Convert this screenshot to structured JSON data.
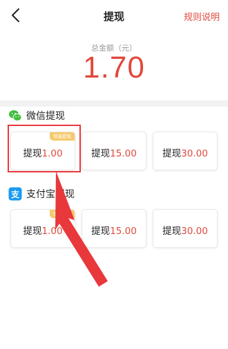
{
  "nav": {
    "title": "提现",
    "rules_label": "规则说明"
  },
  "summary": {
    "label": "总金额（元）",
    "amount": "1.70"
  },
  "wechat": {
    "title": "微信提现",
    "options": [
      {
        "prefix": "提现",
        "amount": "1.00",
        "badge": "快速提现"
      },
      {
        "prefix": "提现",
        "amount": "15.00"
      },
      {
        "prefix": "提现",
        "amount": "30.00"
      }
    ]
  },
  "alipay": {
    "title": "支付宝提现",
    "options": [
      {
        "prefix": "提现",
        "amount": "1.00",
        "badge": "快速提现"
      },
      {
        "prefix": "提现",
        "amount": "15.00"
      },
      {
        "prefix": "提现",
        "amount": "30.00"
      }
    ]
  },
  "colors": {
    "accent": "#e0493c",
    "wechat_green": "#3fbe3a",
    "alipay_blue": "#1a9bef",
    "badge_gold": "#f5c96b",
    "highlight_red": "#e8383b"
  },
  "icons": {
    "back": "chevron-left-icon",
    "wechat": "wechat-icon",
    "alipay": "alipay-icon"
  }
}
